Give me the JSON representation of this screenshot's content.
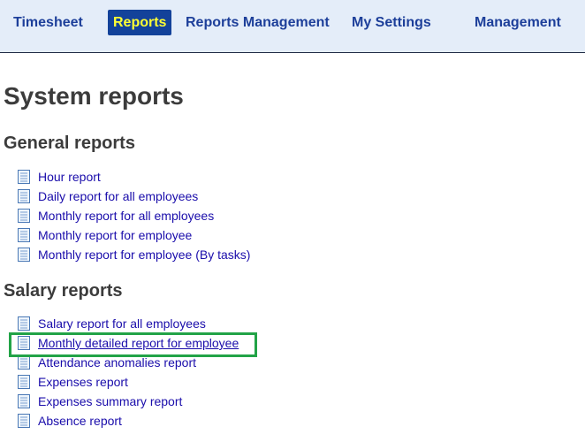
{
  "nav": {
    "items": [
      {
        "label": "Timesheet"
      },
      {
        "label": "Reports"
      },
      {
        "label": "Reports Management"
      },
      {
        "label": "My Settings"
      },
      {
        "label": "Management"
      }
    ]
  },
  "page": {
    "title": "System reports"
  },
  "sections": [
    {
      "title": "General reports",
      "reports": [
        {
          "label": "Hour report"
        },
        {
          "label": "Daily report for all employees"
        },
        {
          "label": "Monthly report for all employees"
        },
        {
          "label": "Monthly report for employee"
        },
        {
          "label": "Monthly report for employee (By tasks)"
        }
      ]
    },
    {
      "title": "Salary reports",
      "reports": [
        {
          "label": "Salary report for all employees"
        },
        {
          "label": "Monthly detailed report for employee"
        },
        {
          "label": "Attendance anomalies report"
        },
        {
          "label": "Expenses report"
        },
        {
          "label": "Expenses summary report"
        },
        {
          "label": "Absence report"
        }
      ]
    }
  ],
  "icons": {
    "report_icon": "document-icon"
  },
  "colors": {
    "nav_background": "#e4edf9",
    "nav_active_background": "#13429a",
    "nav_active_text": "#ffff33",
    "nav_text": "#1d3f9a",
    "link": "#1a0dab",
    "highlight_border": "#22a347"
  }
}
